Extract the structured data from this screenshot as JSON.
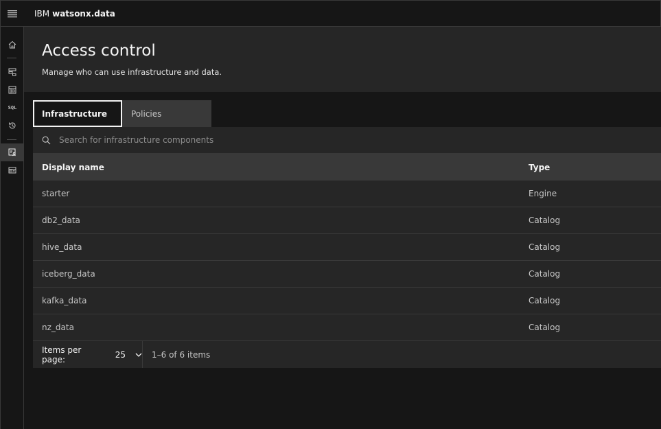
{
  "header": {
    "brand_prefix": "IBM",
    "brand_product": "watsonx.data"
  },
  "sidenav": {
    "items": [
      {
        "icon": "home-icon"
      },
      {
        "icon": "infrastructure-icon"
      },
      {
        "icon": "data-manager-icon"
      },
      {
        "icon": "sql-icon",
        "text": "SQL"
      },
      {
        "icon": "history-icon"
      },
      {
        "icon": "access-control-icon",
        "active": true
      },
      {
        "icon": "workspace-icon"
      }
    ]
  },
  "page": {
    "title": "Access control",
    "subtitle": "Manage who can use infrastructure and data."
  },
  "tabs": [
    {
      "label": "Infrastructure",
      "selected": true
    },
    {
      "label": "Policies",
      "selected": false
    }
  ],
  "search": {
    "placeholder": "Search for infrastructure components"
  },
  "table": {
    "columns": [
      "Display name",
      "Type"
    ],
    "rows": [
      {
        "name": "starter",
        "type": "Engine"
      },
      {
        "name": "db2_data",
        "type": "Catalog"
      },
      {
        "name": "hive_data",
        "type": "Catalog"
      },
      {
        "name": "iceberg_data",
        "type": "Catalog"
      },
      {
        "name": "kafka_data",
        "type": "Catalog"
      },
      {
        "name": "nz_data",
        "type": "Catalog"
      }
    ]
  },
  "pagination": {
    "items_per_page_label": "Items per page:",
    "items_per_page_value": "25",
    "range_text": "1–6 of 6 items"
  },
  "colors": {
    "background": "#161616",
    "layer": "#262626",
    "layer_accent": "#393939",
    "text_primary": "#f4f4f4",
    "text_secondary": "#c6c6c6"
  }
}
